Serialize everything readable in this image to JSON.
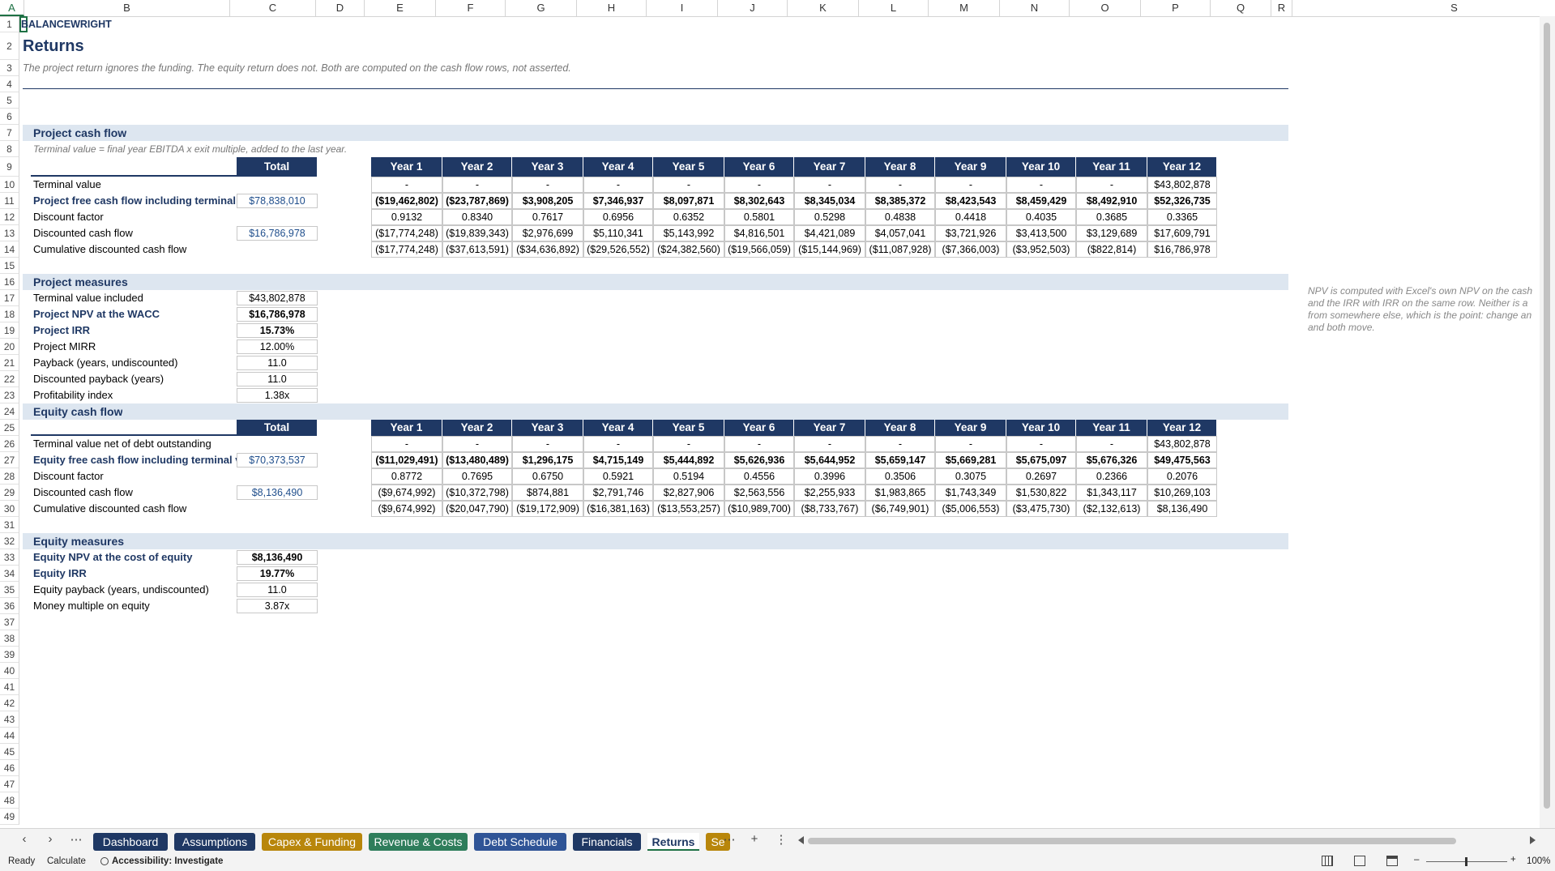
{
  "columns": [
    "A",
    "B",
    "C",
    "D",
    "E",
    "F",
    "G",
    "H",
    "I",
    "J",
    "K",
    "L",
    "M",
    "N",
    "O",
    "P",
    "Q",
    "R",
    "S"
  ],
  "rows": [
    "1",
    "2",
    "3",
    "4",
    "5",
    "6",
    "7",
    "8",
    "9",
    "10",
    "11",
    "12",
    "13",
    "14",
    "15",
    "16",
    "17",
    "18",
    "19",
    "20",
    "21",
    "22",
    "23",
    "24",
    "25",
    "26",
    "27",
    "28",
    "29",
    "30",
    "31",
    "32",
    "33",
    "34",
    "35",
    "36",
    "37",
    "38",
    "39",
    "40",
    "41",
    "42",
    "43",
    "44",
    "45",
    "46",
    "47",
    "48",
    "49"
  ],
  "sheet": {
    "brand": "BALANCEWRIGHT",
    "title": "Returns",
    "subtitle": "The project return ignores the funding. The equity return does not. Both are computed on the cash flow rows, not asserted.",
    "project_cf": {
      "section": "Project cash flow",
      "note": "Terminal value = final year EBITDA x exit multiple, added to the last year.",
      "total_label": "Total",
      "years": [
        "Year 1",
        "Year 2",
        "Year 3",
        "Year 4",
        "Year 5",
        "Year 6",
        "Year 7",
        "Year 8",
        "Year 9",
        "Year 10",
        "Year 11",
        "Year 12"
      ],
      "rows": [
        {
          "label": "Terminal value",
          "total": "",
          "bold": false,
          "values": [
            "-",
            "-",
            "-",
            "-",
            "-",
            "-",
            "-",
            "-",
            "-",
            "-",
            "-",
            "$43,802,878"
          ]
        },
        {
          "label": "Project free cash flow including terminal va",
          "total": "$78,838,010",
          "bold": true,
          "values": [
            "($19,462,802)",
            "($23,787,869)",
            "$3,908,205",
            "$7,346,937",
            "$8,097,871",
            "$8,302,643",
            "$8,345,034",
            "$8,385,372",
            "$8,423,543",
            "$8,459,429",
            "$8,492,910",
            "$52,326,735"
          ]
        },
        {
          "label": "Discount factor",
          "total": "",
          "bold": false,
          "values": [
            "0.9132",
            "0.8340",
            "0.7617",
            "0.6956",
            "0.6352",
            "0.5801",
            "0.5298",
            "0.4838",
            "0.4418",
            "0.4035",
            "0.3685",
            "0.3365"
          ]
        },
        {
          "label": "Discounted cash flow",
          "total": "$16,786,978",
          "bold": false,
          "values": [
            "($17,774,248)",
            "($19,839,343)",
            "$2,976,699",
            "$5,110,341",
            "$5,143,992",
            "$4,816,501",
            "$4,421,089",
            "$4,057,041",
            "$3,721,926",
            "$3,413,500",
            "$3,129,689",
            "$17,609,791"
          ]
        },
        {
          "label": "Cumulative discounted cash flow",
          "total": "",
          "bold": false,
          "values": [
            "($17,774,248)",
            "($37,613,591)",
            "($34,636,892)",
            "($29,526,552)",
            "($24,382,560)",
            "($19,566,059)",
            "($15,144,969)",
            "($11,087,928)",
            "($7,366,003)",
            "($3,952,503)",
            "($822,814)",
            "$16,786,978"
          ]
        }
      ]
    },
    "project_measures": {
      "section": "Project measures",
      "rows": [
        {
          "label": "Terminal value included",
          "value": "$43,802,878",
          "bold": false
        },
        {
          "label": "Project NPV at the WACC",
          "value": "$16,786,978",
          "bold": true
        },
        {
          "label": "Project IRR",
          "value": "15.73%",
          "bold": true
        },
        {
          "label": "Project MIRR",
          "value": "12.00%",
          "bold": false
        },
        {
          "label": "Payback (years, undiscounted)",
          "value": "11.0",
          "bold": false
        },
        {
          "label": "Discounted payback (years)",
          "value": "11.0",
          "bold": false
        },
        {
          "label": "Profitability index",
          "value": "1.38x",
          "bold": false
        }
      ]
    },
    "side_note": [
      "NPV is computed with Excel's own NPV on the cash",
      "and the IRR with IRR on the same row. Neither is a",
      "from somewhere else, which is the point: change an",
      "and both move."
    ],
    "equity_cf": {
      "section": "Equity cash flow",
      "total_label": "Total",
      "years": [
        "Year 1",
        "Year 2",
        "Year 3",
        "Year 4",
        "Year 5",
        "Year 6",
        "Year 7",
        "Year 8",
        "Year 9",
        "Year 10",
        "Year 11",
        "Year 12"
      ],
      "rows": [
        {
          "label": "Terminal value net of debt outstanding",
          "total": "",
          "bold": false,
          "values": [
            "-",
            "-",
            "-",
            "-",
            "-",
            "-",
            "-",
            "-",
            "-",
            "-",
            "-",
            "$43,802,878"
          ]
        },
        {
          "label": "Equity free cash flow including terminal val",
          "total": "$70,373,537",
          "bold": true,
          "values": [
            "($11,029,491)",
            "($13,480,489)",
            "$1,296,175",
            "$4,715,149",
            "$5,444,892",
            "$5,626,936",
            "$5,644,952",
            "$5,659,147",
            "$5,669,281",
            "$5,675,097",
            "$5,676,326",
            "$49,475,563"
          ]
        },
        {
          "label": "Discount factor",
          "total": "",
          "bold": false,
          "values": [
            "0.8772",
            "0.7695",
            "0.6750",
            "0.5921",
            "0.5194",
            "0.4556",
            "0.3996",
            "0.3506",
            "0.3075",
            "0.2697",
            "0.2366",
            "0.2076"
          ]
        },
        {
          "label": "Discounted cash flow",
          "total": "$8,136,490",
          "bold": false,
          "values": [
            "($9,674,992)",
            "($10,372,798)",
            "$874,881",
            "$2,791,746",
            "$2,827,906",
            "$2,563,556",
            "$2,255,933",
            "$1,983,865",
            "$1,743,349",
            "$1,530,822",
            "$1,343,117",
            "$10,269,103"
          ]
        },
        {
          "label": "Cumulative discounted cash flow",
          "total": "",
          "bold": false,
          "values": [
            "($9,674,992)",
            "($20,047,790)",
            "($19,172,909)",
            "($16,381,163)",
            "($13,553,257)",
            "($10,989,700)",
            "($8,733,767)",
            "($6,749,901)",
            "($5,006,553)",
            "($3,475,730)",
            "($2,132,613)",
            "$8,136,490"
          ]
        }
      ]
    },
    "equity_measures": {
      "section": "Equity measures",
      "rows": [
        {
          "label": "Equity NPV at the cost of equity",
          "value": "$8,136,490",
          "bold": true
        },
        {
          "label": "Equity IRR",
          "value": "19.77%",
          "bold": true
        },
        {
          "label": "Equity payback (years, undiscounted)",
          "value": "11.0",
          "bold": false
        },
        {
          "label": "Money multiple on equity",
          "value": "3.87x",
          "bold": false
        }
      ]
    }
  },
  "tabs": [
    {
      "label": "Dashboard",
      "color": "#1f3864"
    },
    {
      "label": "Assumptions",
      "color": "#1f3864"
    },
    {
      "label": "Capex & Funding",
      "color": "#b8860b"
    },
    {
      "label": "Revenue & Costs",
      "color": "#2e7d5b"
    },
    {
      "label": "Debt Schedule",
      "color": "#2f5496"
    },
    {
      "label": "Financials",
      "color": "#1f3864"
    },
    {
      "label": "Returns",
      "color": "",
      "active": true
    },
    {
      "label": "Se",
      "color": "#b8860b"
    }
  ],
  "tab_controls": {
    "more": "⋯",
    "add": "+",
    "menu": "⋮",
    "prev": "‹",
    "next": "›",
    "more_left": "⋯"
  },
  "status": {
    "ready": "Ready",
    "calculate": "Calculate",
    "accessibility": "Accessibility: Investigate",
    "zoom": "100%",
    "minus": "–",
    "plus": "+"
  },
  "colors": {
    "navy": "#1f3864",
    "band": "#dde6f0",
    "excel_green": "#1e7145"
  }
}
